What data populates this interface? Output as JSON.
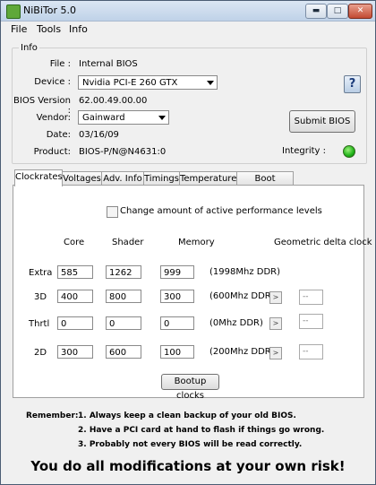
{
  "window": {
    "title": "NiBiTor 5.0",
    "min_glyph": "▬",
    "max_glyph": "□",
    "close_glyph": "✕"
  },
  "menu": [
    "File",
    "Tools",
    "Info"
  ],
  "info": {
    "group_label": "Info",
    "file_label": "File :",
    "file_value": "Internal BIOS",
    "device_label": "Device :",
    "device_value": "Nvidia PCI-E 260 GTX",
    "bios_version_label": "BIOS Version :",
    "bios_version_value": "62.00.49.00.00",
    "vendor_label": "Vendor:",
    "vendor_value": "Gainward",
    "date_label": "Date:",
    "date_value": "03/16/09",
    "product_label": "Product:",
    "product_value": "BIOS-P/N@N4631:0",
    "integrity_label": "Integrity :",
    "integrity_status_color": "#1fb318",
    "help_glyph": "?",
    "submit_label": "Submit BIOS"
  },
  "tabs": [
    "Clockrates",
    "Voltages",
    "Adv. Info",
    "Timings",
    "Temperatures",
    "Boot Settings"
  ],
  "clockrates": {
    "checkbox_label": "Change amount of active performance levels",
    "headers": {
      "core": "Core",
      "shader": "Shader",
      "memory": "Memory",
      "geo": "Geometric delta clock"
    },
    "rows": [
      {
        "label": "Extra",
        "core": "585",
        "shader": "1262",
        "memory": "999",
        "note": "(1998Mhz DDR)"
      },
      {
        "label": "3D",
        "core": "400",
        "shader": "800",
        "memory": "300",
        "note": "(600Mhz DDR)",
        "step": ">",
        "geo": "--"
      },
      {
        "label": "Thrtl",
        "core": "0",
        "shader": "0",
        "memory": "0",
        "note": "(0Mhz DDR)",
        "step": ">",
        "geo": "--"
      },
      {
        "label": "2D",
        "core": "300",
        "shader": "600",
        "memory": "100",
        "note": "(200Mhz DDR)",
        "step": ">",
        "geo": "--"
      }
    ],
    "bootup_label": "Bootup clocks"
  },
  "remember": {
    "label": "Remember:",
    "items": [
      "1. Always keep a clean backup of your old BIOS.",
      "2. Have a PCI card at hand to flash if things go wrong.",
      "3. Probably not every BIOS will be read correctly."
    ]
  },
  "warning": "You do all modifications at your own risk!"
}
